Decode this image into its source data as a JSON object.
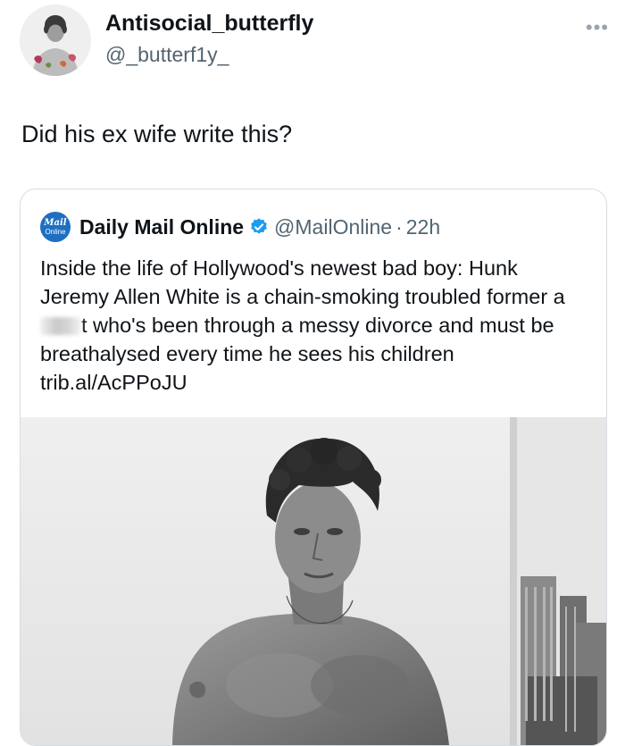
{
  "tweet": {
    "author_name": "Antisocial_butterfly",
    "author_handle": "@_butterf1y_",
    "more_icon": "more-horizontal-icon",
    "text": "Did his ex wife write this?"
  },
  "quoted": {
    "logo_top": "Mail",
    "logo_bottom": "Online",
    "name": "Daily Mail Online",
    "handle": "@MailOnline",
    "separator": "·",
    "time": "22h",
    "verified_icon": "verified-badge-icon",
    "text_before_blur": "Inside the life of Hollywood's newest bad boy: Hunk Jeremy Allen White is a chain-smoking troubled former a",
    "text_after_blur": "t who's been through a messy divorce and must be breathalysed every time he sees his children trib.al/AcPPoJU"
  },
  "colors": {
    "text_primary": "#0f1419",
    "text_secondary": "#536471",
    "verified_blue": "#1d9bf0",
    "mail_blue": "#1e6fc0",
    "border": "#d6dde3"
  }
}
